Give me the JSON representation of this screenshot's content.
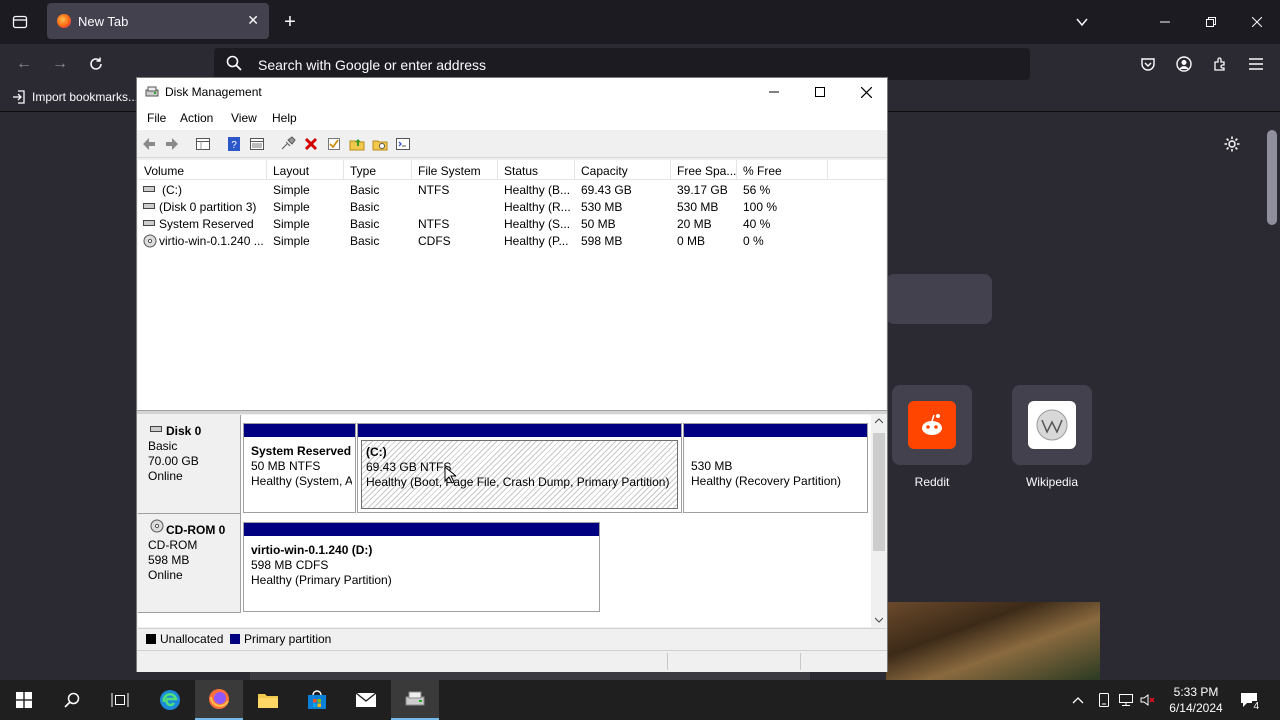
{
  "browser": {
    "tab_title": "New Tab",
    "url_placeholder": "Search with Google or enter address",
    "import_bookmarks": "Import bookmarks...",
    "shortcuts": [
      {
        "label": "Reddit"
      },
      {
        "label": "Wikipedia"
      }
    ]
  },
  "window": {
    "title": "Disk Management",
    "menu": [
      "File",
      "Action",
      "View",
      "Help"
    ]
  },
  "volume_table": {
    "columns": [
      "Volume",
      "Layout",
      "Type",
      "File System",
      "Status",
      "Capacity",
      "Free Spa...",
      "% Free"
    ],
    "rows": [
      [
        "(C:)",
        "Simple",
        "Basic",
        "NTFS",
        "Healthy (B...",
        "69.43 GB",
        "39.17 GB",
        "56 %"
      ],
      [
        "(Disk 0 partition 3)",
        "Simple",
        "Basic",
        "",
        "Healthy (R...",
        "530 MB",
        "530 MB",
        "100 %"
      ],
      [
        "System Reserved",
        "Simple",
        "Basic",
        "NTFS",
        "Healthy (S...",
        "50 MB",
        "20 MB",
        "40 %"
      ],
      [
        "virtio-win-0.1.240 ...",
        "Simple",
        "Basic",
        "CDFS",
        "Healthy (P...",
        "598 MB",
        "0 MB",
        "0 %"
      ]
    ]
  },
  "disks": [
    {
      "name": "Disk 0",
      "type": "Basic",
      "size": "70.00 GB",
      "state": "Online",
      "partitions": [
        {
          "title": "System Reserved",
          "line2": "50 MB NTFS",
          "line3": "Healthy (System, A"
        },
        {
          "title": "(C:)",
          "line2": "69.43 GB NTFS",
          "line3": "Healthy (Boot, Page File, Crash Dump, Primary Partition)"
        },
        {
          "title": "",
          "line2": "530 MB",
          "line3": "Healthy (Recovery Partition)"
        }
      ]
    },
    {
      "name": "CD-ROM 0",
      "type": "CD-ROM",
      "size": "598 MB",
      "state": "Online",
      "partitions": [
        {
          "title": "virtio-win-0.1.240  (D:)",
          "line2": "598 MB CDFS",
          "line3": "Healthy (Primary Partition)"
        }
      ]
    }
  ],
  "legend": [
    {
      "label": "Unallocated",
      "color": "#000000"
    },
    {
      "label": "Primary partition",
      "color": "#000080"
    }
  ],
  "taskbar": {
    "time": "5:33 PM",
    "date": "6/14/2024",
    "notification_count": "4"
  },
  "colors": {
    "primary_partition": "#000080",
    "firefox_bg": "#2b2a33"
  }
}
